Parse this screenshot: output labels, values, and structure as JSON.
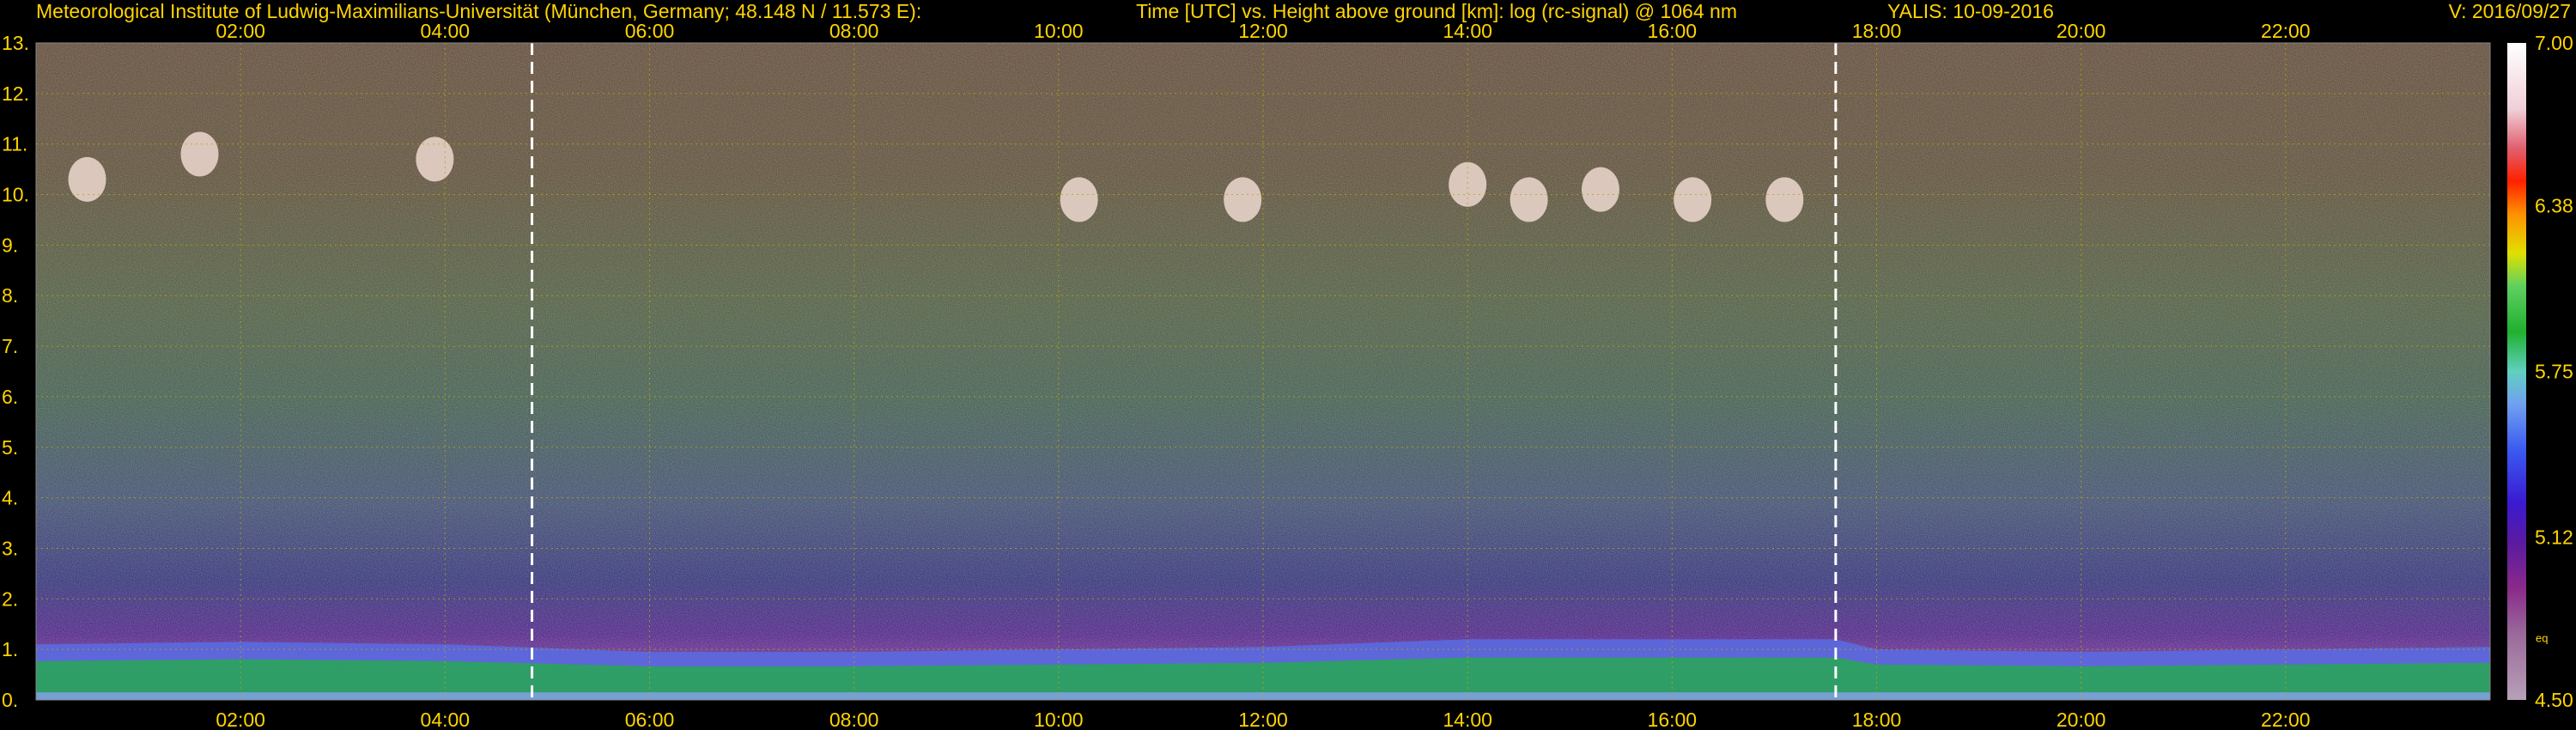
{
  "header": {
    "institute": "Meteorological Institute of Ludwig-Maximilians-Universität (München, Germany; 48.148 N / 11.573 E):",
    "description": "Time [UTC] vs. Height above ground [km]: log (rc-signal) @ 1064 nm",
    "instrument_date": "YALIS: 10-09-2016",
    "version": "V: 2016/09/27"
  },
  "chart_data": {
    "type": "heatmap",
    "title": "Time [UTC] vs. Height above ground [km]: log (rc-signal) @ 1064 nm",
    "xlabel": "",
    "ylabel": "",
    "x_unit": "hours UTC",
    "xlim": [
      0,
      24
    ],
    "ylim": [
      0,
      13
    ],
    "x_ticks": [
      2,
      4,
      6,
      8,
      10,
      12,
      14,
      16,
      18,
      20,
      22
    ],
    "x_tick_labels": [
      "02:00",
      "04:00",
      "06:00",
      "08:00",
      "10:00",
      "12:00",
      "14:00",
      "16:00",
      "18:00",
      "20:00",
      "22:00"
    ],
    "y_ticks": [
      0,
      1,
      2,
      3,
      4,
      5,
      6,
      7,
      8,
      9,
      10,
      11,
      12,
      13
    ],
    "y_tick_labels": [
      "0.",
      "1.",
      "2.",
      "3.",
      "4.",
      "5.",
      "6.",
      "7.",
      "8.",
      "9.",
      "10.",
      "11.",
      "12.",
      "13."
    ],
    "grid": true,
    "sunrise_sunset_lines": [
      4.85,
      17.6
    ],
    "boundary_layer_top_km": [
      [
        0,
        1.1
      ],
      [
        2,
        1.15
      ],
      [
        4,
        1.1
      ],
      [
        6,
        0.95
      ],
      [
        8,
        0.95
      ],
      [
        10,
        1.0
      ],
      [
        12,
        1.05
      ],
      [
        14,
        1.2
      ],
      [
        16,
        1.2
      ],
      [
        17.6,
        1.2
      ],
      [
        18,
        1.0
      ],
      [
        20,
        0.95
      ],
      [
        22,
        1.0
      ],
      [
        24,
        1.05
      ]
    ],
    "cirrus_patches": [
      {
        "t": 0.5,
        "h": 10.3
      },
      {
        "t": 1.6,
        "h": 10.8
      },
      {
        "t": 3.9,
        "h": 10.7
      },
      {
        "t": 10.2,
        "h": 9.9
      },
      {
        "t": 11.8,
        "h": 9.9
      },
      {
        "t": 14.0,
        "h": 10.2
      },
      {
        "t": 14.6,
        "h": 9.9
      },
      {
        "t": 15.3,
        "h": 10.1
      },
      {
        "t": 16.2,
        "h": 9.9
      },
      {
        "t": 17.1,
        "h": 9.9
      }
    ],
    "colorbar": {
      "min": 4.5,
      "max": 7.0,
      "ticks": [
        4.5,
        5.12,
        5.75,
        6.38,
        7.0
      ],
      "tick_labels": [
        "4.50",
        "5.12",
        "5.75",
        "6.38",
        "7.00"
      ],
      "annotation": "eq"
    },
    "colors": {
      "text": "#ffd400",
      "grid": "#b8a800",
      "marker_lines": "#ffffff",
      "background": "#000000"
    }
  }
}
